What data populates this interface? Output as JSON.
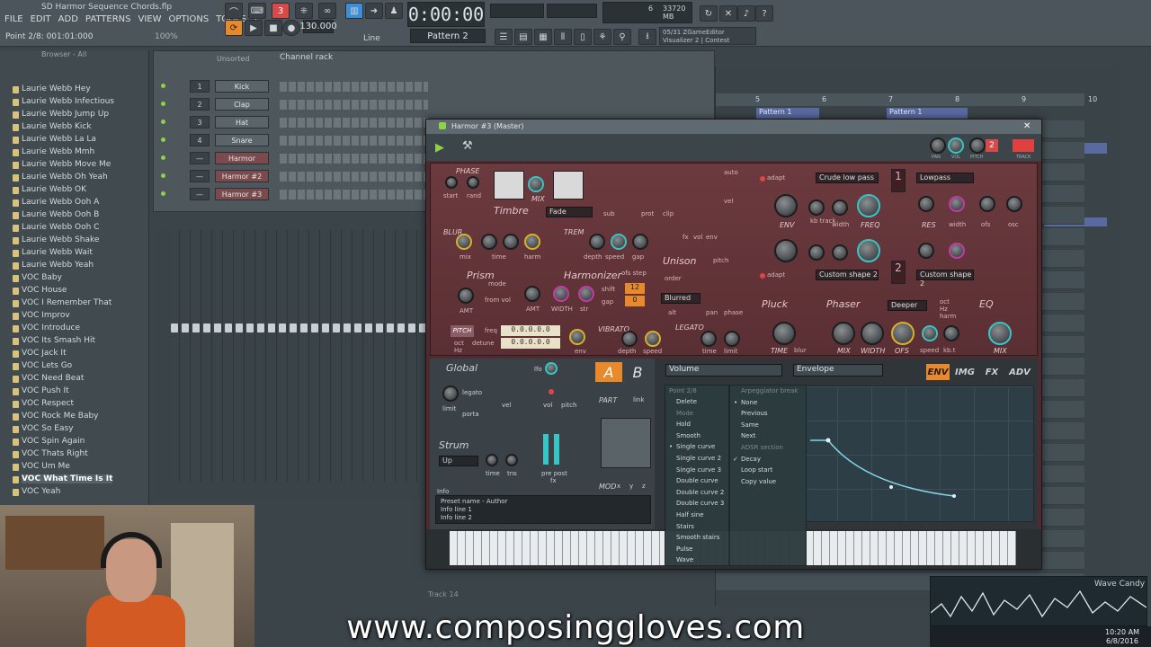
{
  "app": {
    "project_title": "SD Harmor Sequence Chords.flp",
    "menu": [
      "FILE",
      "EDIT",
      "ADD",
      "PATTERNS",
      "VIEW",
      "OPTIONS",
      "TOOLS",
      "?"
    ],
    "hint_text": "Point 2/8: 001:01:000",
    "zoom": "100%",
    "time": "0:00:00",
    "tempo": "130.000",
    "pattern": "Pattern 2",
    "line_select": "Line",
    "cpu_mem": "33720 MB",
    "cpu_count": "6",
    "hint_panel": {
      "line1": "05/31  ZGameEditor",
      "line2": "Visualizer 2 | Contest"
    }
  },
  "browser": {
    "header": "Browser - All",
    "items": [
      "Laurie Webb Hey",
      "Laurie Webb Infectious",
      "Laurie Webb Jump Up",
      "Laurie Webb Kick",
      "Laurie Webb La La",
      "Laurie Webb Mmh",
      "Laurie Webb Move Me",
      "Laurie Webb Oh Yeah",
      "Laurie Webb OK",
      "Laurie Webb Ooh A",
      "Laurie Webb Ooh B",
      "Laurie Webb Ooh C",
      "Laurie Webb Shake",
      "Laurie Webb Wait",
      "Laurie Webb Yeah",
      "VOC Baby",
      "VOC House",
      "VOC I Remember That",
      "VOC Improv",
      "VOC Introduce",
      "VOC Its Smash Hit",
      "VOC Jack It",
      "VOC Lets Go",
      "VOC Need Beat",
      "VOC Push It",
      "VOC Respect",
      "VOC Rock Me Baby",
      "VOC So Easy",
      "VOC Spin Again",
      "VOC Thats Right",
      "VOC Um Me",
      "VOC What Time Is It",
      "VOC Yeah"
    ],
    "selected_index": 31
  },
  "channel_rack": {
    "title": "Channel rack",
    "filter": "Unsorted",
    "channels": [
      {
        "num": "1",
        "name": "Kick"
      },
      {
        "num": "2",
        "name": "Clap"
      },
      {
        "num": "3",
        "name": "Hat"
      },
      {
        "num": "4",
        "name": "Snare"
      },
      {
        "num": "—",
        "name": "Harmor"
      },
      {
        "num": "—",
        "name": "Harmor #2"
      },
      {
        "num": "—",
        "name": "Harmor #3"
      }
    ]
  },
  "playlist": {
    "clips": [
      "Pattern 1",
      "Pattern 1"
    ],
    "bar_numbers": [
      "5",
      "6",
      "7",
      "8",
      "9",
      "10"
    ],
    "track_label": "Track 14"
  },
  "harmor": {
    "title": "Harmor #3 (Master)",
    "labels": {
      "phase": "PHASE",
      "start": "start",
      "rand": "rand",
      "timbre": "Timbre",
      "mix": "MIX",
      "fade": "Fade",
      "sub": "sub",
      "prot": "prot",
      "clip": "clip",
      "auto": "auto",
      "fx": "fx",
      "vol": "vol",
      "env": "env",
      "vel": "vel",
      "blur": "BLUR",
      "bmix": "mix",
      "time": "time",
      "harm": "harm",
      "trem": "TREM",
      "depth": "depth",
      "speed": "speed",
      "gap": "gap",
      "unison": "Unison",
      "order": "order",
      "pitch": "pitch",
      "pan": "pan",
      "phase2": "phase",
      "prism": "Prism",
      "mode": "mode",
      "from_vol": "from vol",
      "amt": "AMT",
      "width": "WIDTH",
      "str": "str",
      "harmonizer": "Harmonizer",
      "ofs_step": "ofs step",
      "shift": "shift",
      "blurred": "Blurred",
      "alt": "alt",
      "pitch_btn": "PITCH",
      "freq": "freq",
      "detune": "detune",
      "oct": "oct",
      "hz": "Hz",
      "vibrato": "VIBRATO",
      "legato": "LEGATO",
      "limit": "limit",
      "envsmall": "env",
      "adapt": "adapt",
      "crude": "Crude low pass",
      "lowpass": "Lowpass",
      "f_env": "ENV",
      "kb_track": "kb track",
      "f_width": "width",
      "freqbig": "FREQ",
      "res": "RES",
      "ofs": "ofs",
      "osc": "osc",
      "custom2a": "Custom shape 2",
      "custom2b": "Custom shape 2",
      "pluck": "Pluck",
      "phaser": "Phaser",
      "deeper": "Deeper",
      "eq": "EQ",
      "p_time": "TIME",
      "p_blur": "blur",
      "p_mix": "MIX",
      "p_width": "WIDTH",
      "p_ofs": "OFS",
      "p_speed": "speed",
      "kb_t": "kb.t",
      "harm2": "harm",
      "eq_mix": "MIX",
      "pan_top": "PAN",
      "vol_top": "VOL",
      "pitch_top": "PITCH",
      "range": "RANGE",
      "track": "TRACK",
      "filter_num_1": "1",
      "filter_num_2": "2",
      "track_num": "2",
      "fvalue": "0.0.0.0.0",
      "dvalue": "0.0.0.0.0",
      "shift_val": "12",
      "gap_val": "0"
    },
    "global": {
      "title": "Global",
      "lfo": "lfo",
      "legato": "legato",
      "vel": "vel",
      "limit": "limit",
      "porta": "porta",
      "vol": "vol",
      "pitch": "pitch",
      "part": "PART",
      "link": "link",
      "strum": "Strum",
      "strum_mode": "Up",
      "time": "time",
      "tns": "tns",
      "pre_post": "pre post",
      "fx": "fx",
      "mod": "MOD",
      "x": "x",
      "y": "y",
      "z": "z",
      "tab_a": "A",
      "tab_b": "B"
    },
    "env_panel": {
      "target": "Volume",
      "type": "Envelope",
      "tabs": [
        "ENV",
        "IMG",
        "FX",
        "ADV"
      ]
    },
    "info": {
      "label": "Info",
      "line1": "Preset name - Author",
      "line2": "Info line 1",
      "line3": "Info line 2"
    }
  },
  "context_menu_left": {
    "header": "Point 2/8",
    "items": [
      {
        "label": "Delete",
        "state": "normal"
      },
      {
        "label": "Mode",
        "state": "dim"
      },
      {
        "label": "Hold",
        "state": "normal"
      },
      {
        "label": "Smooth",
        "state": "normal"
      },
      {
        "label": "Single curve",
        "state": "selected"
      },
      {
        "label": "Single curve 2",
        "state": "normal"
      },
      {
        "label": "Single curve 3",
        "state": "normal"
      },
      {
        "label": "Double curve",
        "state": "normal"
      },
      {
        "label": "Double curve 2",
        "state": "normal"
      },
      {
        "label": "Double curve 3",
        "state": "normal"
      },
      {
        "label": "Half sine",
        "state": "normal"
      },
      {
        "label": "Stairs",
        "state": "normal"
      },
      {
        "label": "Smooth stairs",
        "state": "normal"
      },
      {
        "label": "Pulse",
        "state": "normal"
      },
      {
        "label": "Wave",
        "state": "normal"
      }
    ]
  },
  "context_menu_right": {
    "items": [
      {
        "label": "Arpeggiator break",
        "state": "dim"
      },
      {
        "label": "None",
        "state": "selected"
      },
      {
        "label": "Previous",
        "state": "normal"
      },
      {
        "label": "Same",
        "state": "normal"
      },
      {
        "label": "Next",
        "state": "normal"
      },
      {
        "label": "ADSR section",
        "state": "dim"
      },
      {
        "label": "Decay",
        "state": "checked"
      },
      {
        "label": "Loop start",
        "state": "normal"
      },
      {
        "label": "Copy value",
        "state": "normal"
      }
    ]
  },
  "overlay": {
    "banner": "www.composinggloves.com",
    "wave_candy": "Wave Candy",
    "clock_time": "10:20 AM",
    "clock_date": "6/8/2016"
  },
  "colors": {
    "accent_orange": "#e8892c",
    "harmor_body": "#6b3a3f",
    "knob_cyan": "#39c4c6",
    "knob_magenta": "#c23ba4",
    "led_green": "#8fd24a"
  }
}
